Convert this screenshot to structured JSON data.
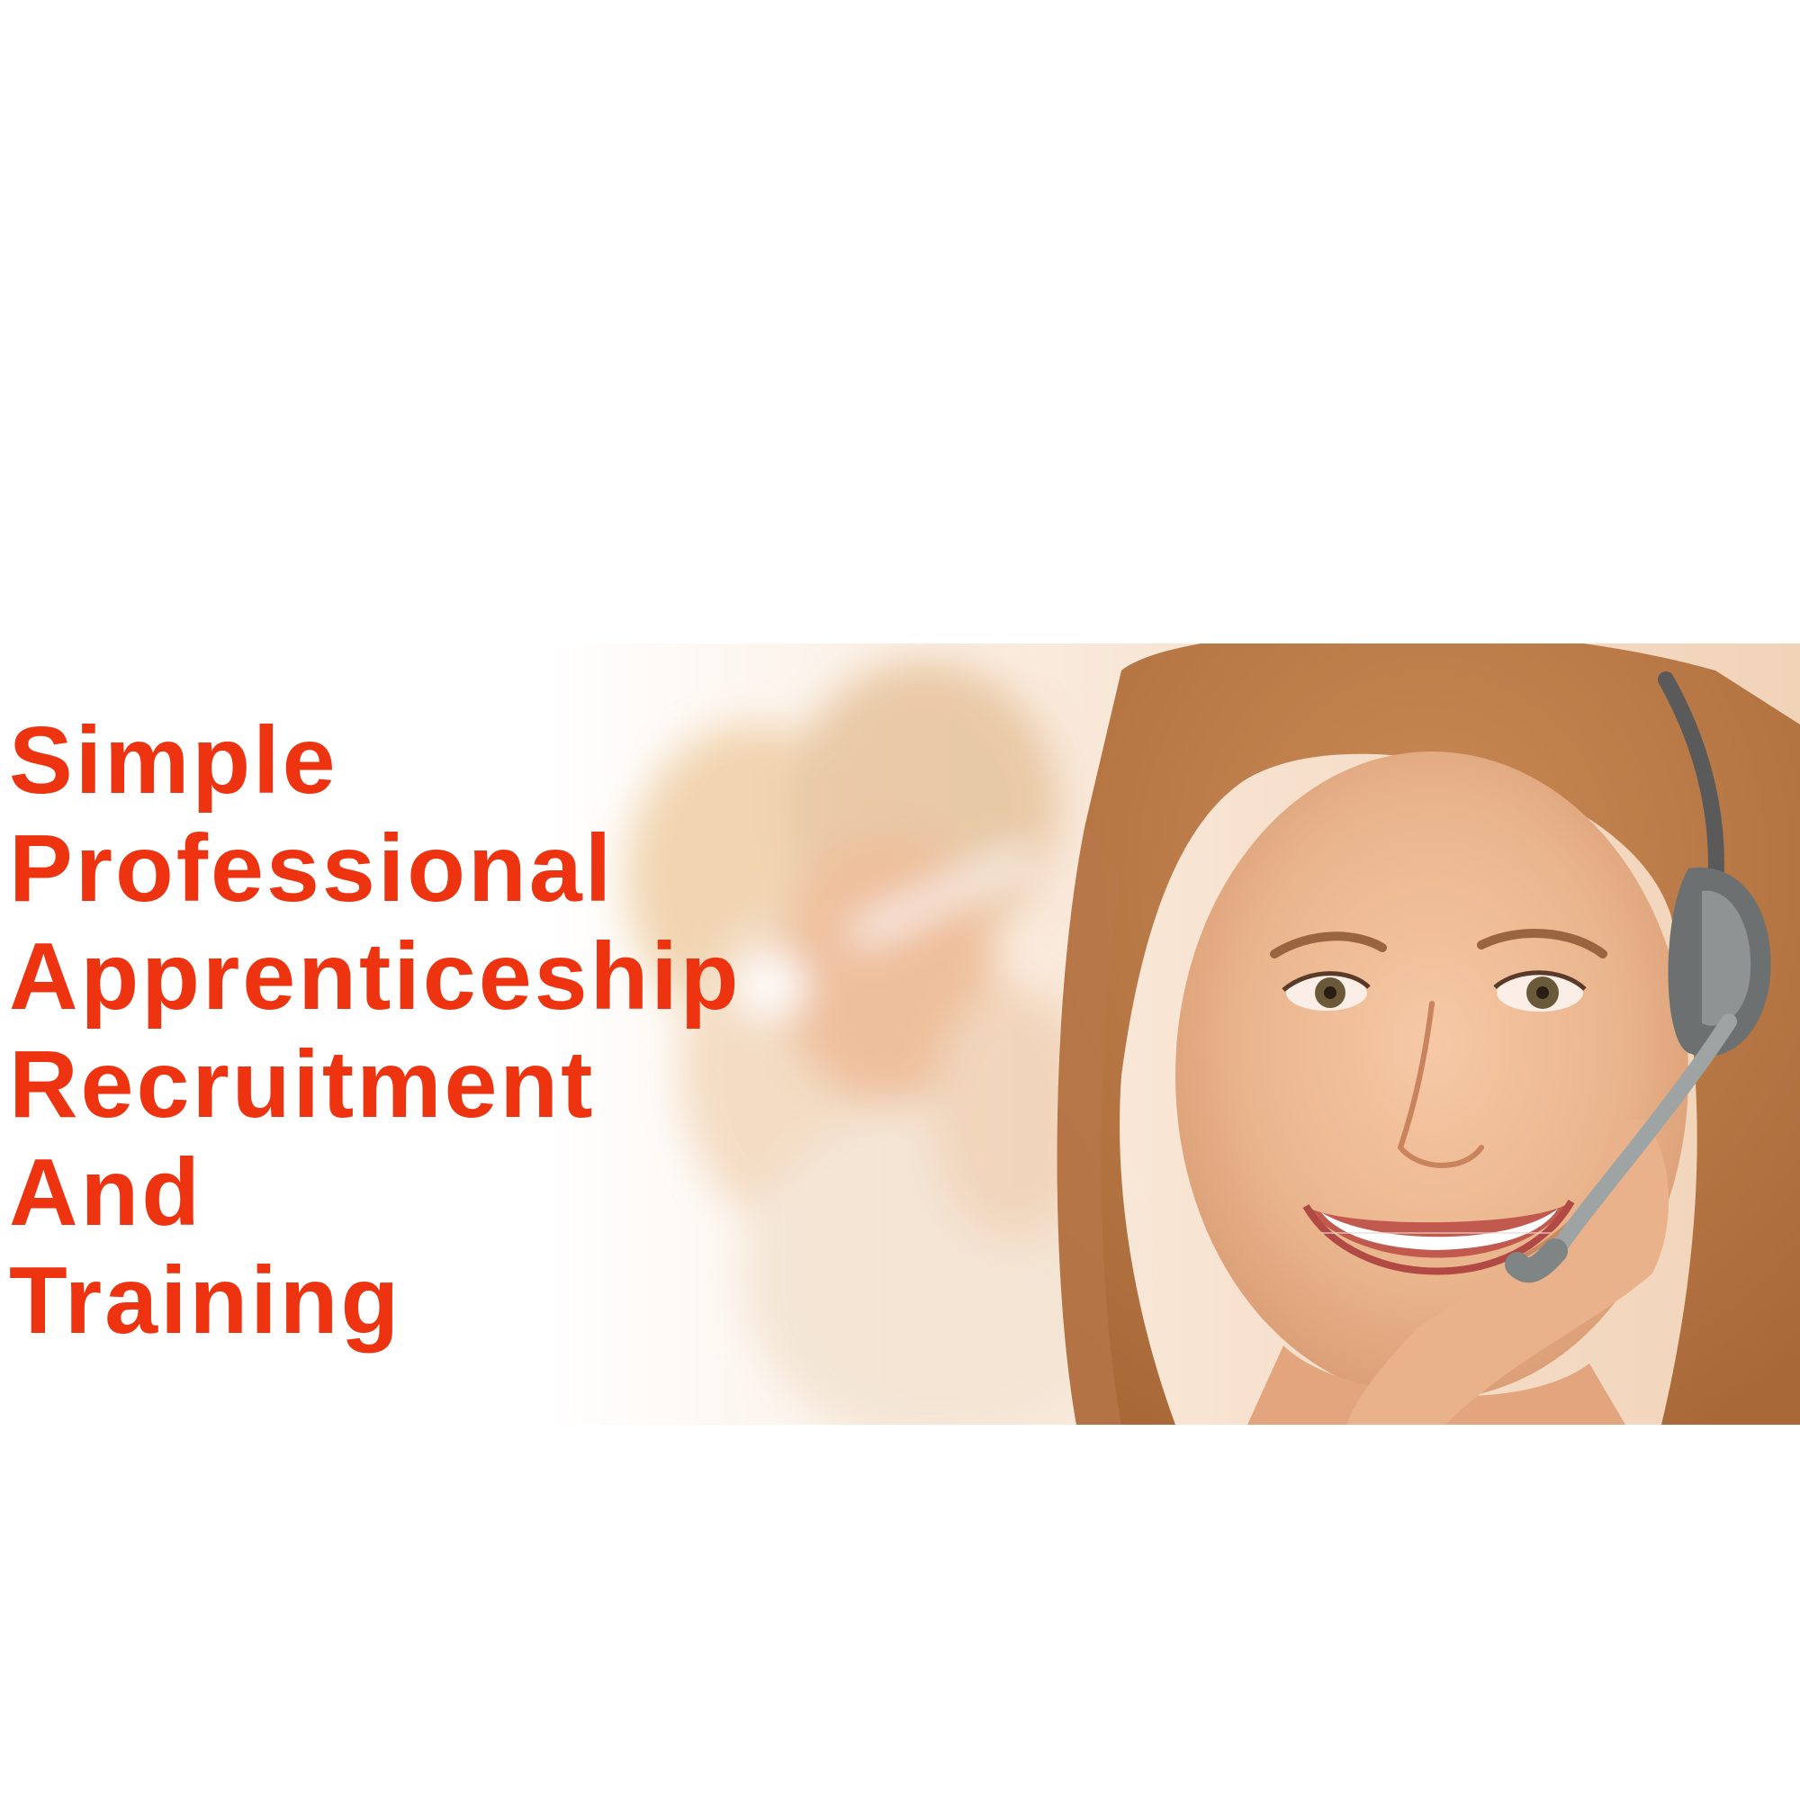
{
  "colors": {
    "headline": "#ee3311",
    "background": "#ffffff",
    "photo_warm": "#e8b48e",
    "photo_light": "#fdf3ea"
  },
  "headline": {
    "lines": [
      "Simple",
      "Professional",
      "Apprenticeship",
      "Recruitment",
      "And",
      "Training"
    ]
  },
  "photo": {
    "icon": "call-center-agent-photo",
    "subject": "smiling woman wearing a headset"
  }
}
